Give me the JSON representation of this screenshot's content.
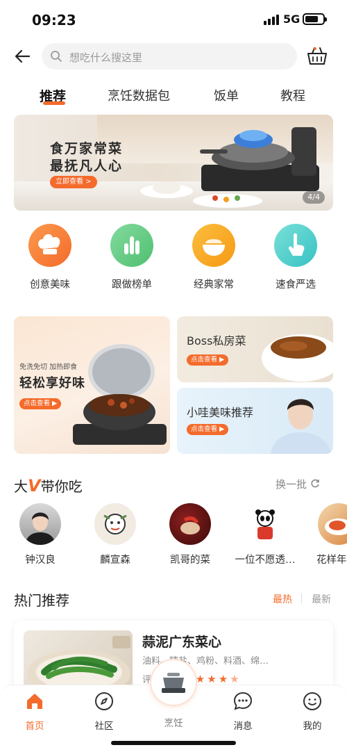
{
  "status_bar": {
    "time": "09:23",
    "network": "5G"
  },
  "search": {
    "placeholder": "想吃什么搜这里"
  },
  "tabs": [
    {
      "label": "推荐",
      "active": true
    },
    {
      "label": "烹饪数据包",
      "active": false
    },
    {
      "label": "饭单",
      "active": false
    },
    {
      "label": "教程",
      "active": false
    }
  ],
  "banner": {
    "line1": "食万家常菜",
    "line2": "最抚凡人心",
    "cta": "立即查看 >",
    "pager": "4/4"
  },
  "categories": [
    {
      "label": "创意美味",
      "icon": "chef-hat-icon",
      "color": "#f7762f"
    },
    {
      "label": "跟做榜单",
      "icon": "bar-chart-icon",
      "color": "#5fc97a"
    },
    {
      "label": "经典家常",
      "icon": "rice-bowl-icon",
      "color": "#f9a21f"
    },
    {
      "label": "速食严选",
      "icon": "hand-pointer-icon",
      "color": "#3fc8c6"
    }
  ],
  "promos": {
    "big": {
      "subtitle": "免洗免切 加热即食",
      "title": "轻松享好味",
      "cta": "点击查看"
    },
    "boss": {
      "title": "Boss私房菜",
      "cta": "点击查看"
    },
    "xiaowa": {
      "title": "小哇美味推荐",
      "cta": "点击查看"
    }
  },
  "big_v": {
    "title_prefix": "大",
    "title_v": "V",
    "title_suffix": "带你吃",
    "refresh": "换一批",
    "people": [
      {
        "name": "钟汉良"
      },
      {
        "name": "麟宣森"
      },
      {
        "name": "凯哥的菜"
      },
      {
        "name": "一位不愿透…"
      },
      {
        "name": "花样年"
      }
    ]
  },
  "hot": {
    "title": "热门推荐",
    "sort_hot": "最热",
    "sort_new": "最新",
    "card": {
      "dish": "蒜泥广东菜心",
      "ingredients": "油料、精盐、鸡粉、料酒、绵…",
      "rating": 4.5
    }
  },
  "nav": [
    {
      "label": "首页",
      "icon": "home-icon",
      "active": true
    },
    {
      "label": "社区",
      "icon": "compass-icon",
      "active": false
    },
    {
      "label": "烹饪",
      "icon": "cooker-icon",
      "active": false
    },
    {
      "label": "消息",
      "icon": "message-icon",
      "active": false
    },
    {
      "label": "我的",
      "icon": "profile-icon",
      "active": false
    }
  ],
  "colors": {
    "accent": "#f46b2c"
  }
}
